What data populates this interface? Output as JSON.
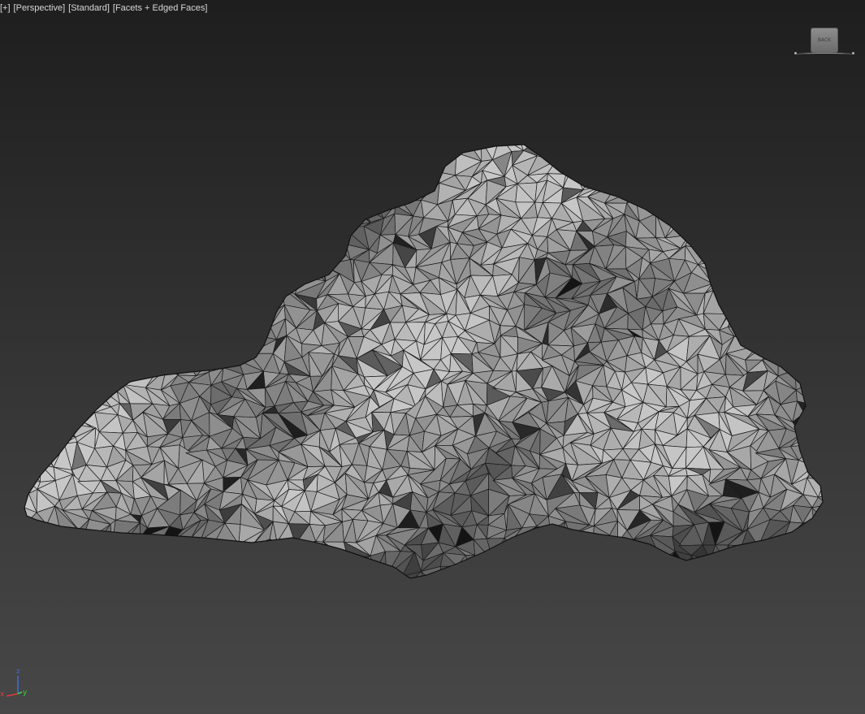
{
  "viewport": {
    "label_parts": [
      "[+]",
      "[Perspective]",
      "[Standard]",
      "[Facets + Edged Faces]"
    ],
    "background_top": "#1e1e1e",
    "background_bottom": "#474747"
  },
  "viewcube": {
    "face_label": "BACK",
    "face_color": "#7d7d7d"
  },
  "mesh": {
    "object_type": "rock-mesh",
    "face_color": "#a3a3a3",
    "shadow_color": "#5a5a5a",
    "edge_color": "#1a1a1a"
  },
  "axis_tripod": {
    "x_label": "x",
    "y_label": "y",
    "z_label": "z",
    "x_color": "#e03c3c",
    "y_color": "#3cd23c",
    "z_color": "#3c6ee0"
  }
}
